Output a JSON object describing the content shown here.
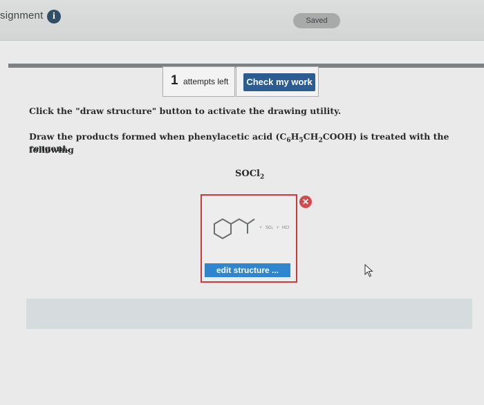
{
  "header": {
    "title": "signment",
    "info_icon": "info-icon",
    "saved_label": "Saved"
  },
  "toolbar": {
    "attempts_count": "1",
    "attempts_label": "attempts left",
    "check_label": "Check my work"
  },
  "question": {
    "line1": "Click the \"draw structure\" button to activate the drawing utility.",
    "line2_pre": "Draw the products formed when phenylacetic acid (C",
    "sub6": "6",
    "h": "H",
    "sub5": "5",
    "ch": "CH",
    "sub2": "2",
    "line2_post": "COOH) is treated with the following",
    "line3": "reagent.",
    "reagent_main": "SOCl",
    "reagent_sub": "2"
  },
  "structure": {
    "close_symbol": "✕",
    "edit_label": "edit structure ...",
    "byproduct1": "SO₂",
    "plus": "+",
    "byproduct2": "HCl"
  },
  "colors": {
    "check_button": "#2b5d92",
    "edit_button": "#2f86cf",
    "structure_border": "#d2383b",
    "saved_badge": "#a7aaa9"
  }
}
